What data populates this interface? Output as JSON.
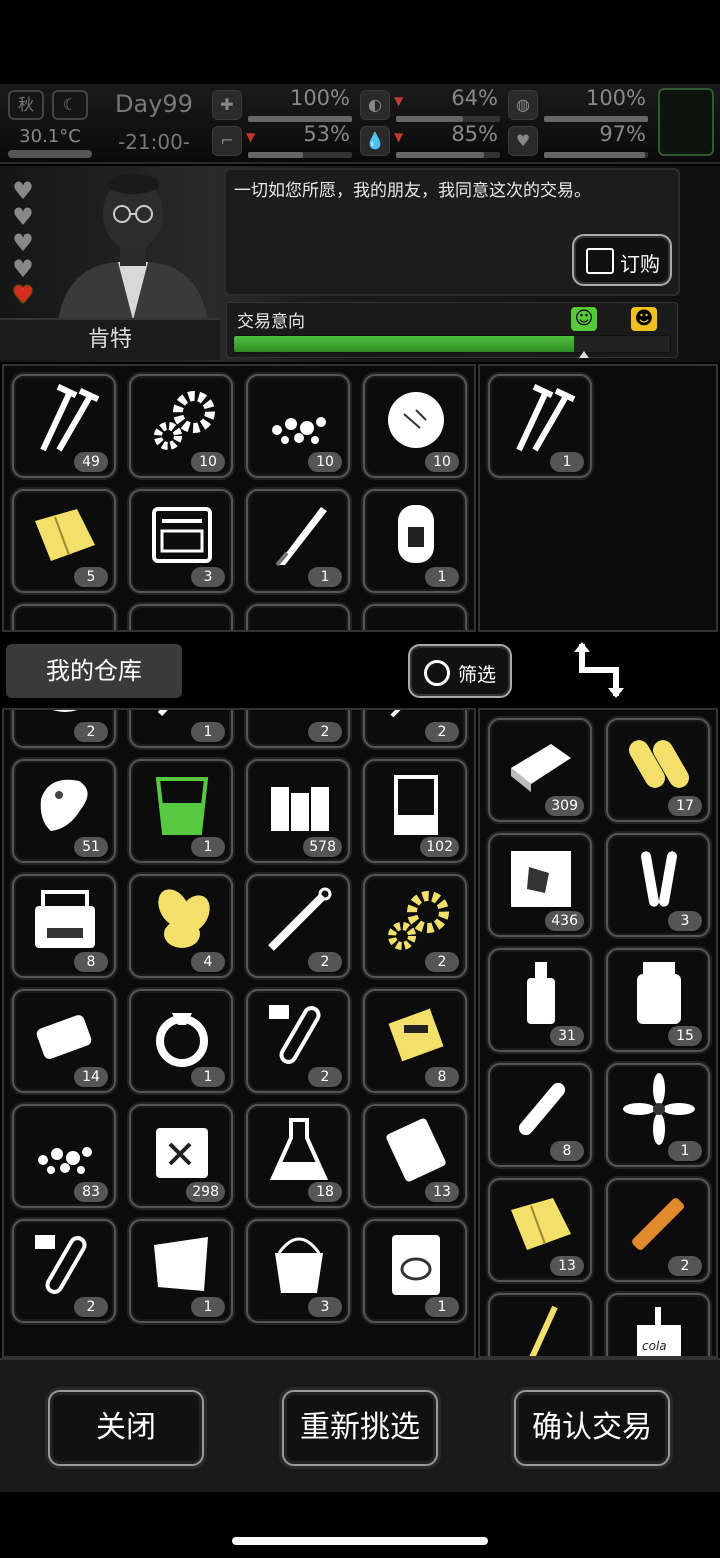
{
  "hud": {
    "season": "秋",
    "temperature": "30.1°C",
    "day": "Day99",
    "time": "-21:00-",
    "stats": [
      {
        "name": "health",
        "value": "100%",
        "fill": 1.0
      },
      {
        "name": "hunger",
        "value": "64%",
        "fill": 0.64
      },
      {
        "name": "energy",
        "value": "100%",
        "fill": 1.0
      },
      {
        "name": "stamina",
        "value": "53%",
        "fill": 0.53
      },
      {
        "name": "thirst",
        "value": "85%",
        "fill": 0.85
      },
      {
        "name": "mood",
        "value": "97%",
        "fill": 0.97
      }
    ]
  },
  "trader": {
    "name": "肯特",
    "dialogue": "一切如您所愿，我的朋友，我同意这次的交易。",
    "order_label": "订购",
    "intent_label": "交易意向",
    "intent_level": 0.78,
    "hearts": [
      false,
      false,
      false,
      false,
      true
    ]
  },
  "trader_stock": [
    {
      "icon": "nails-icon",
      "count": "49"
    },
    {
      "icon": "gears-icon",
      "count": "10"
    },
    {
      "icon": "rubble-icon",
      "count": "10"
    },
    {
      "icon": "cotton-icon",
      "count": "10"
    },
    {
      "icon": "cloth-icon",
      "count": "5"
    },
    {
      "icon": "toolkit-icon",
      "count": "3"
    },
    {
      "icon": "machete-icon",
      "count": "1"
    },
    {
      "icon": "backpack-icon",
      "count": "1"
    }
  ],
  "trader_offer": [
    {
      "icon": "nails-icon",
      "count": "1"
    }
  ],
  "warehouse": {
    "tab_label": "我的仓库",
    "filter_label": "筛选"
  },
  "my_items": [
    {
      "icon": "stone-icon",
      "count": "2"
    },
    {
      "icon": "tools-icon",
      "count": "1"
    },
    {
      "icon": "plank-icon",
      "count": "2"
    },
    {
      "icon": "knife-icon",
      "count": "2"
    },
    {
      "icon": "meat-icon",
      "count": "51"
    },
    {
      "icon": "water-glass-icon",
      "count": "1"
    },
    {
      "icon": "wood-icon",
      "count": "578"
    },
    {
      "icon": "beaker-icon",
      "count": "102"
    },
    {
      "icon": "repair-kit-icon",
      "count": "8"
    },
    {
      "icon": "leaves-icon",
      "count": "4"
    },
    {
      "icon": "syringe-icon",
      "count": "2"
    },
    {
      "icon": "gears-gold-icon",
      "count": "2"
    },
    {
      "icon": "soap-icon",
      "count": "14"
    },
    {
      "icon": "ring-icon",
      "count": "1"
    },
    {
      "icon": "test-tube-3-icon",
      "count": "2"
    },
    {
      "icon": "circuit-icon",
      "count": "8"
    },
    {
      "icon": "rubble-icon",
      "count": "83"
    },
    {
      "icon": "fuel-can-icon",
      "count": "298"
    },
    {
      "icon": "flask-icon",
      "count": "18"
    },
    {
      "icon": "bag-icon",
      "count": "13"
    },
    {
      "icon": "test-tube-2-icon",
      "count": "2"
    },
    {
      "icon": "tarp-icon",
      "count": "1"
    },
    {
      "icon": "bucket-icon",
      "count": "3"
    },
    {
      "icon": "food-pack-icon",
      "count": "1"
    }
  ],
  "my_offer": [
    {
      "icon": "brick-icon",
      "count": "309"
    },
    {
      "icon": "bullets-icon",
      "count": "17"
    },
    {
      "icon": "jigsaw-icon",
      "count": "436"
    },
    {
      "icon": "ampoules-icon",
      "count": "3"
    },
    {
      "icon": "bottle-icon",
      "count": "31"
    },
    {
      "icon": "jar-icon",
      "count": "15"
    },
    {
      "icon": "cigar-icon",
      "count": "8"
    },
    {
      "icon": "flower-icon",
      "count": "1"
    },
    {
      "icon": "cloth-icon",
      "count": "13"
    },
    {
      "icon": "injector-icon",
      "count": "2"
    },
    {
      "icon": "rope-icon",
      "count": ""
    },
    {
      "icon": "cola-icon",
      "count": ""
    }
  ],
  "cola_text": "cola",
  "footer": {
    "close_label": "关闭",
    "reselect_label": "重新挑选",
    "confirm_label": "确认交易"
  }
}
